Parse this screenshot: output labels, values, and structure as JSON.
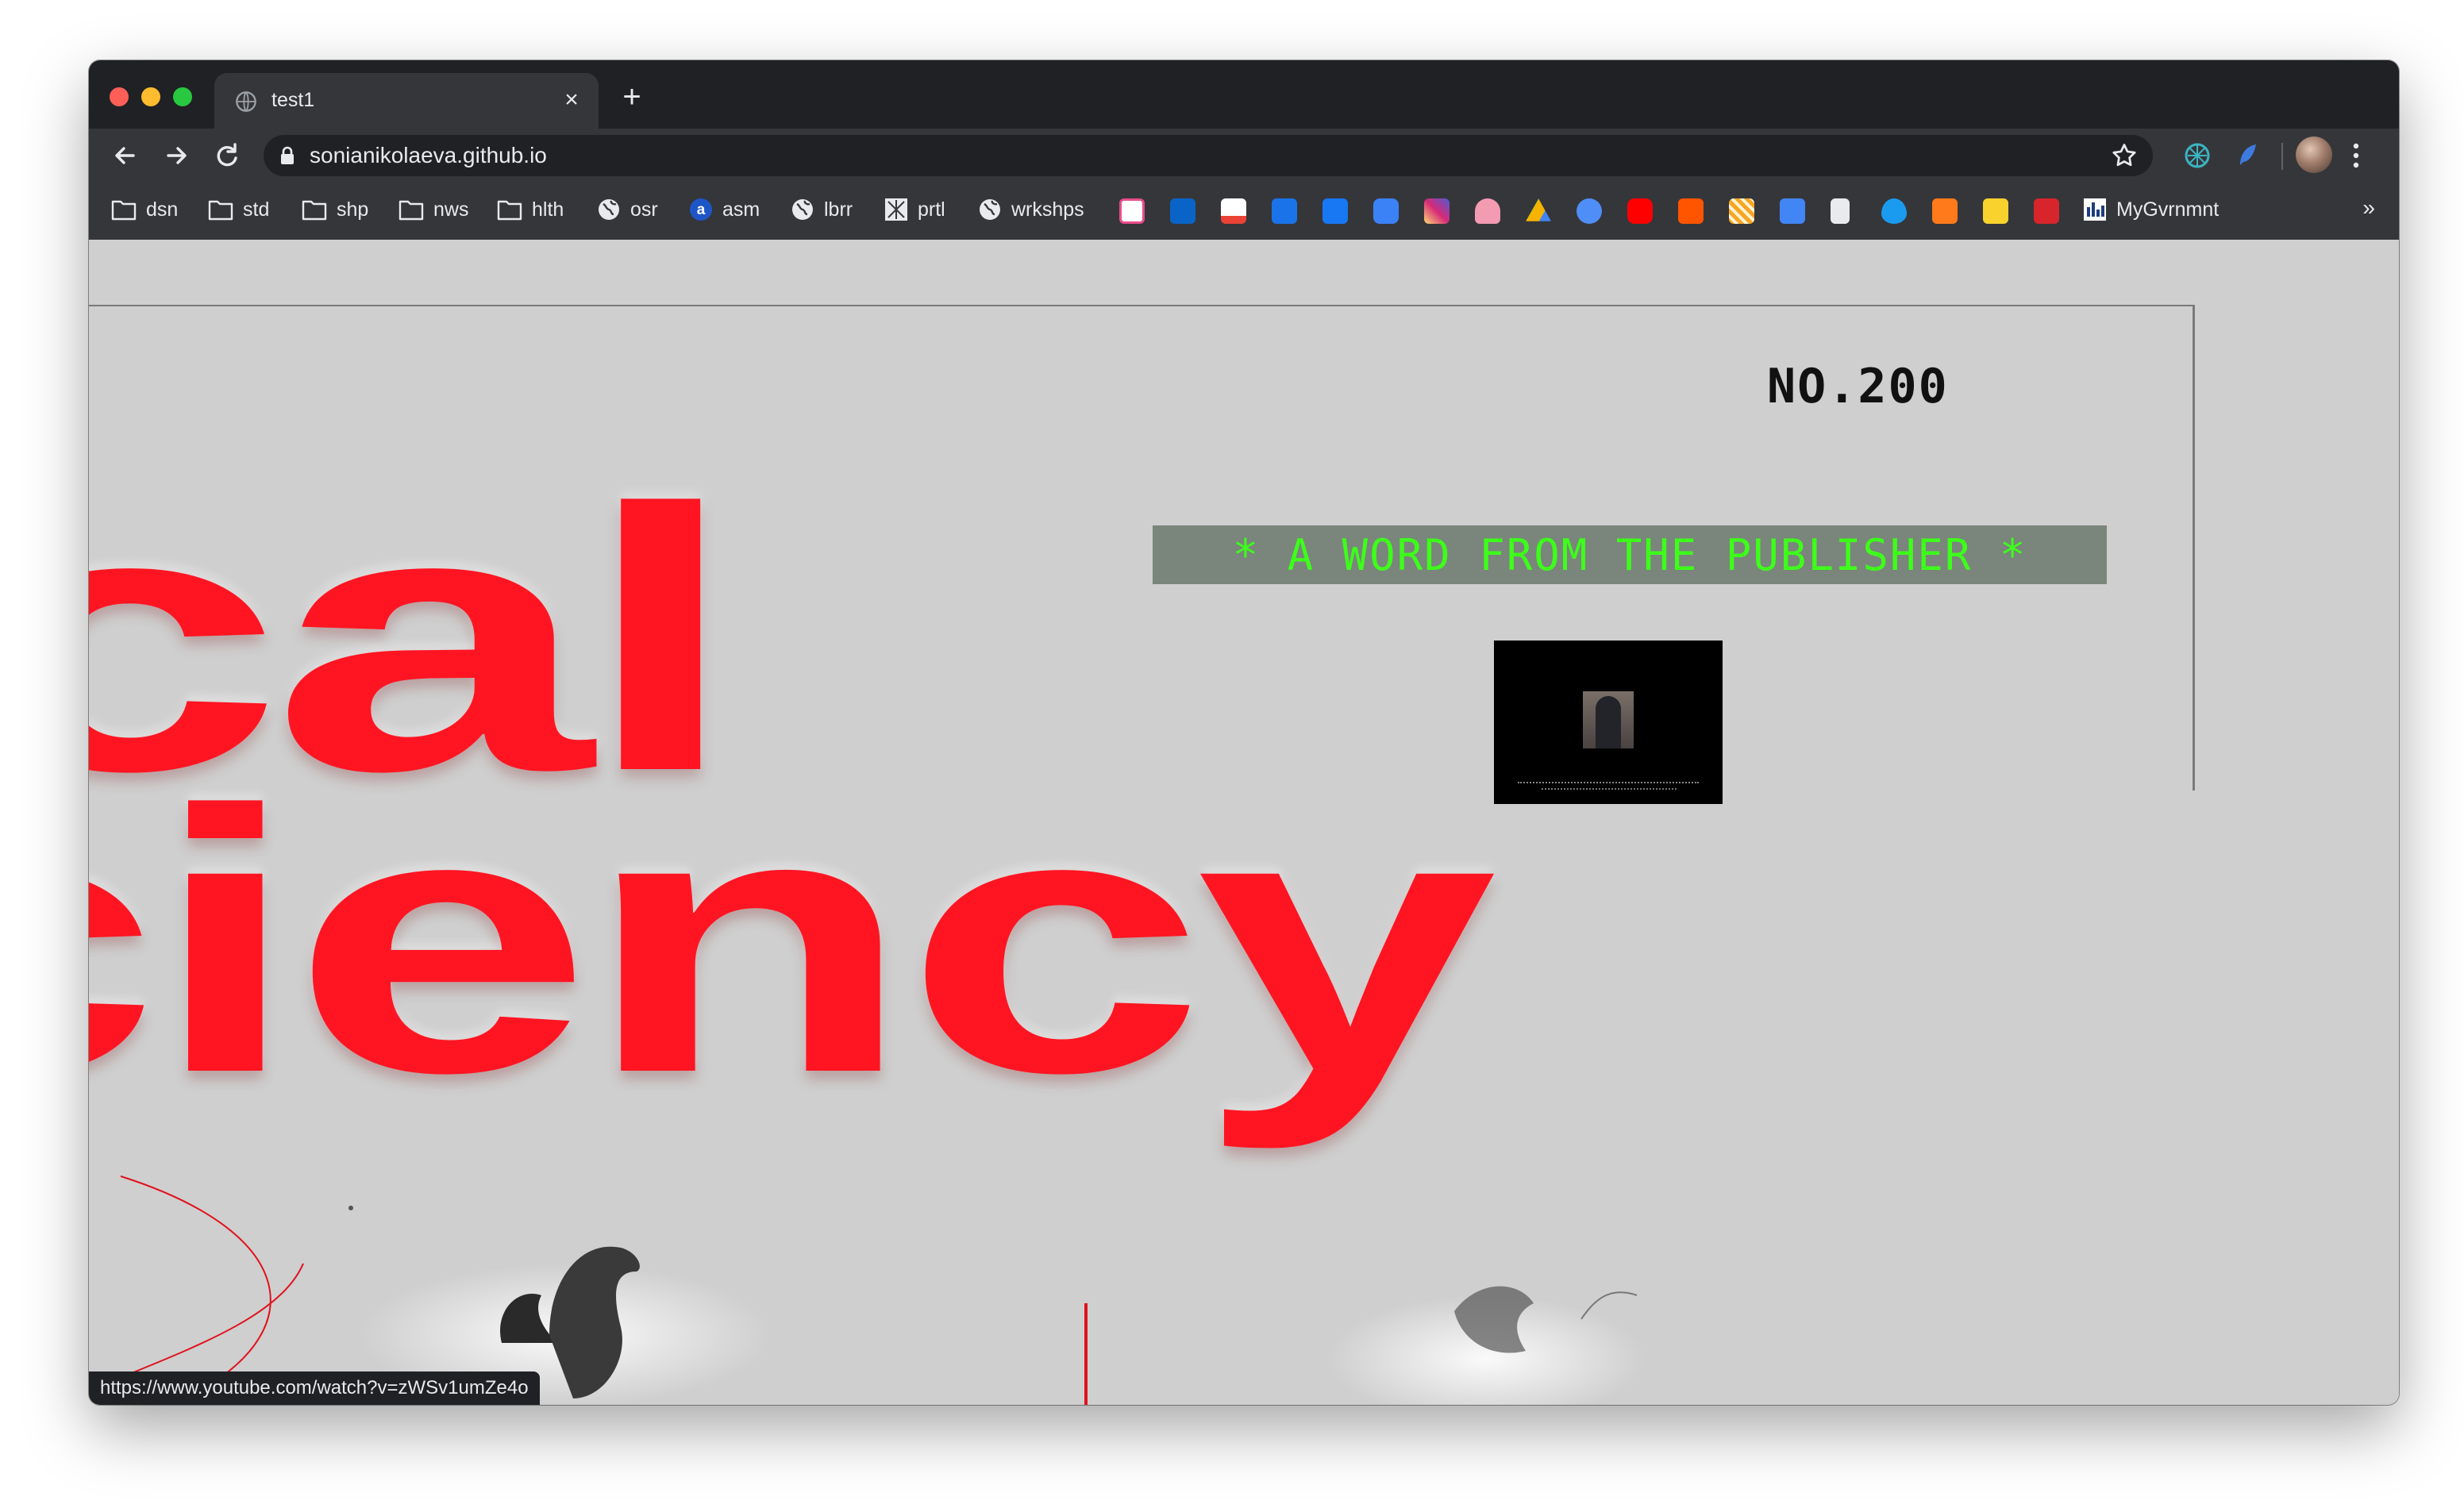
{
  "browser": {
    "tab": {
      "title": "test1"
    },
    "address": {
      "url": "sonianikolaeva.github.io"
    },
    "bookmarks": [
      {
        "label": "dsn",
        "icon": "folder-icon"
      },
      {
        "label": "std",
        "icon": "folder-icon"
      },
      {
        "label": "shp",
        "icon": "folder-icon"
      },
      {
        "label": "nws",
        "icon": "folder-icon"
      },
      {
        "label": "hlth",
        "icon": "folder-icon"
      },
      {
        "label": "osr",
        "icon": "globe-icon"
      },
      {
        "label": "asm",
        "icon": "a-logo-icon"
      },
      {
        "label": "lbrr",
        "icon": "globe-icon"
      },
      {
        "label": "prtl",
        "icon": "portal-icon"
      },
      {
        "label": "wrkshps",
        "icon": "globe-icon"
      },
      {
        "label": "MyGvrnmnt",
        "icon": "chart-logo-icon"
      }
    ],
    "bookmark_icons": [
      {
        "name": "scribble-icon",
        "color": "#e84d8a"
      },
      {
        "name": "outlook-icon",
        "color": "#0a64c8"
      },
      {
        "name": "gmail-icon",
        "color": "#ea4335"
      },
      {
        "name": "mail-icon",
        "color": "#1a73e8"
      },
      {
        "name": "facebook-icon",
        "color": "#1877f2"
      },
      {
        "name": "chat-icon",
        "color": "#3b82f6"
      },
      {
        "name": "instagram-icon",
        "color": "#d62976"
      },
      {
        "name": "cloud-pink-icon",
        "color": "#f29bb1"
      },
      {
        "name": "drive-icon",
        "color": "#f4b400"
      },
      {
        "name": "planet-icon",
        "color": "#4f8ef7"
      },
      {
        "name": "youtube-icon",
        "color": "#ff0000"
      },
      {
        "name": "soundcloud-icon",
        "color": "#ff5500"
      },
      {
        "name": "stripes-icon",
        "color": "#f6a623"
      },
      {
        "name": "translate-icon",
        "color": "#4285f4"
      },
      {
        "name": "doc-icon",
        "color": "#e8eaed"
      },
      {
        "name": "drop-icon",
        "color": "#1a9bf0"
      },
      {
        "name": "shield-orange-icon",
        "color": "#ff7a1a"
      },
      {
        "name": "knot-icon",
        "color": "#f9d22e"
      },
      {
        "name": "dn-icon",
        "color": "#d8242b"
      }
    ],
    "bookmarks_more": "»",
    "status_url": "https://www.youtube.com/watch?v=zWSv1umZe4o"
  },
  "page": {
    "headline_line1": "cal",
    "headline_line2": "ciency",
    "issue_number": "NO.200",
    "publisher_banner": "* A WORD FROM THE PUBLISHER *",
    "accent_color": "#ff1522",
    "banner_text_color": "#3dff1a",
    "background_color": "#cfcfcf"
  }
}
